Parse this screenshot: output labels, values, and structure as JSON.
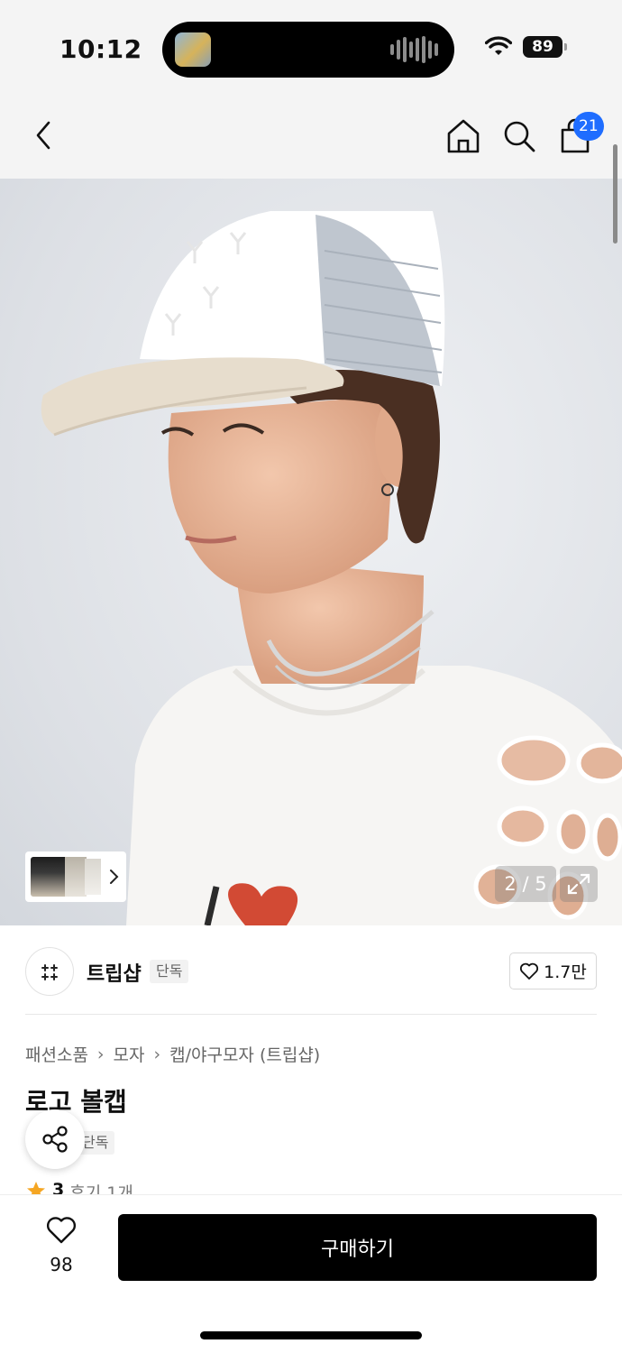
{
  "status_bar": {
    "time": "10:12",
    "battery": "89"
  },
  "nav": {
    "cart_count": "21"
  },
  "gallery": {
    "counter": "2 / 5"
  },
  "brand": {
    "name": "트립샵",
    "tag": "단독",
    "likes": "1.7만"
  },
  "product": {
    "breadcrumb": [
      "패션소품",
      "모자",
      "캡/야구모자 (트립샵)"
    ],
    "title": "로고 볼캡",
    "exclusive_tag": "단독",
    "rating": "3",
    "reviews": "후기 1개"
  },
  "bottom": {
    "wish_count": "98",
    "buy_label": "구매하기"
  },
  "colors": {
    "accent_badge": "#1f6dff",
    "buy_button": "#000000",
    "star": "#f5a623"
  }
}
